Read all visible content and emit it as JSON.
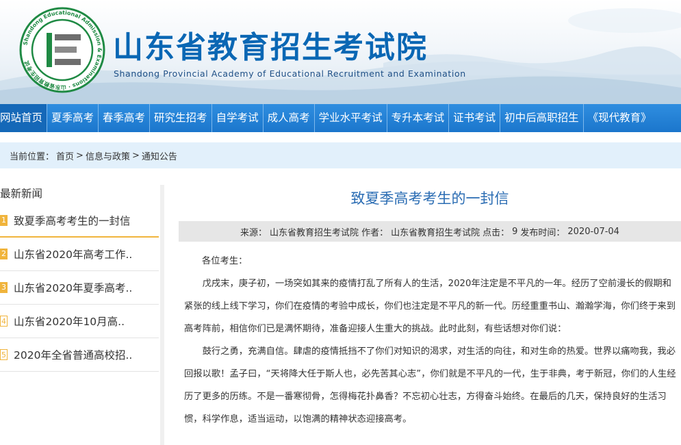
{
  "header": {
    "title": "山东省教育招生考试院",
    "subtitle": "Shandong Provincial Academy of Educational Recruitment and Examination",
    "logo_text": "Shandong Educational Admission & Examinations · 山东省教育招生考试"
  },
  "nav": [
    {
      "label": "网站首页",
      "active": true
    },
    {
      "label": "夏季高考"
    },
    {
      "label": "春季高考"
    },
    {
      "label": "研究生招考"
    },
    {
      "label": "自学考试"
    },
    {
      "label": "成人高考"
    },
    {
      "label": "学业水平考试"
    },
    {
      "label": "专升本考试"
    },
    {
      "label": "证书考试"
    },
    {
      "label": "初中后高职招生"
    },
    {
      "label": "《现代教育》"
    }
  ],
  "breadcrumb": {
    "prefix": "当前位置：",
    "items": [
      "首页",
      "信息与政策",
      "通知公告"
    ],
    "separator": ">"
  },
  "sidebar": {
    "heading": "最新新闻",
    "items": [
      {
        "num": "1",
        "title": "致夏季高考考生的一封信"
      },
      {
        "num": "2",
        "title": "山东省2020年高考工作.."
      },
      {
        "num": "3",
        "title": "山东省2020年夏季高考.."
      },
      {
        "num": "4",
        "title": "山东省2020年10月高.."
      },
      {
        "num": "5",
        "title": "2020年全省普通高校招.."
      }
    ]
  },
  "article": {
    "title": "致夏季高考考生的一封信",
    "meta": {
      "source_label": "来源：",
      "source": "山东省教育招生考试院",
      "author_label": "作者：",
      "author": "山东省教育招生考试院",
      "clicks_label": "点击：",
      "clicks": "9",
      "date_label": "发布时间：",
      "date": "2020-07-04"
    },
    "greeting": "各位考生：",
    "paragraphs": [
      "戊戌末，庚子初，一场突如其来的疫情打乱了所有人的生活，2020年注定是不平凡的一年。经历了空前漫长的假期和紧张的线上线下学习，你们在疫情的考验中成长，你们也注定是不平凡的新一代。历经重重书山、瀚瀚学海，你们终于来到高考阵前，相信你们已是满怀期待，准备迎接人生重大的挑战。此时此刻，有些话想对你们说：",
      "鼓行之勇，充满自信。肆虐的疫情抵挡不了你们对知识的渴求，对生活的向往，和对生命的热爱。世界以痛吻我，我必回报以歌！孟子曰，“天将降大任于斯人也，必先苦其心志”，你们就是不平凡的一代，生于非典，考于新冠，你们的人生经历了更多的历练。不是一番寒彻骨，怎得梅花扑鼻香？不忘初心壮志，方得奋斗始终。在最后的几天，保持良好的生活习惯，科学作息，适当运动，以饱满的精神状态迎接高考。"
    ]
  },
  "colors": {
    "brand_blue": "#0a67b4",
    "nav_blue": "#1b76cc",
    "accent_orange": "#f0b43c",
    "title_blue": "#2a6cb3"
  }
}
